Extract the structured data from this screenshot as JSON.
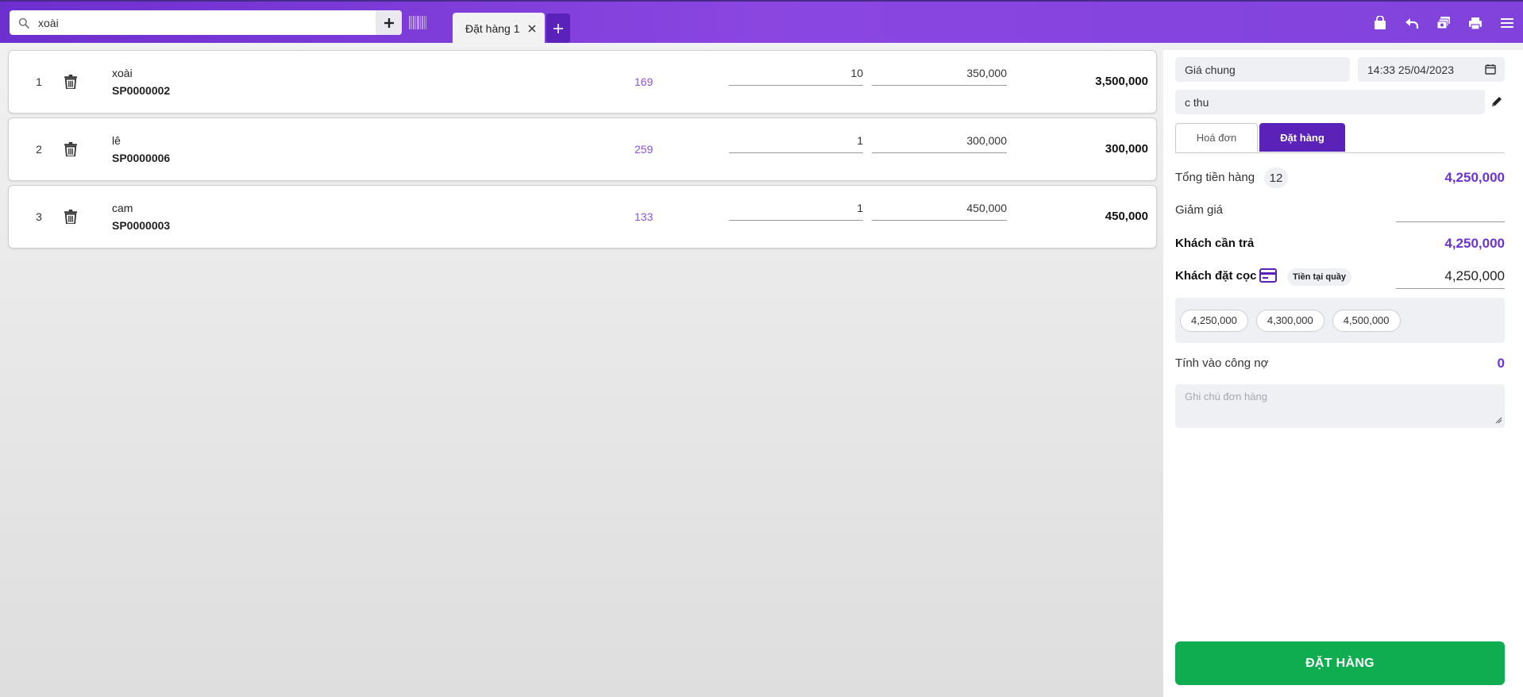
{
  "search": {
    "value": "xoài"
  },
  "tabs": [
    {
      "label": "Đặt hàng 1"
    }
  ],
  "items": [
    {
      "index": "1",
      "name": "xoài",
      "code": "SP0000002",
      "stock": "169",
      "qty": "10",
      "price": "350,000",
      "total": "3,500,000"
    },
    {
      "index": "2",
      "name": "lê",
      "code": "SP0000006",
      "stock": "259",
      "qty": "1",
      "price": "300,000",
      "total": "300,000"
    },
    {
      "index": "3",
      "name": "cam",
      "code": "SP0000003",
      "stock": "133",
      "qty": "1",
      "price": "450,000",
      "total": "450,000"
    }
  ],
  "panel": {
    "price_list": "Giá chung",
    "datetime": "14:33 25/04/2023",
    "customer": "c thu",
    "tab_invoice": "Hoá đơn",
    "tab_order": "Đặt hàng",
    "subtotal_label": "Tổng tiền hàng",
    "item_count": "12",
    "subtotal": "4,250,000",
    "discount_label": "Giảm giá",
    "discount_value": "",
    "payable_label": "Khách cần trả",
    "payable": "4,250,000",
    "deposit_label": "Khách đặt cọc",
    "payment_method": "Tiền tại quầy",
    "deposit": "4,250,000",
    "quick_amounts": [
      "4,250,000",
      "4,300,000",
      "4,500,000"
    ],
    "debt_label": "Tính vào công nợ",
    "debt": "0",
    "note_placeholder": "Ghi chú đơn hàng",
    "submit_label": "ĐẶT HÀNG"
  },
  "colors": {
    "brand": "#7b3fd9",
    "accent": "#6c33d3",
    "active_tab": "#5a22b8",
    "success": "#0fad4f"
  }
}
